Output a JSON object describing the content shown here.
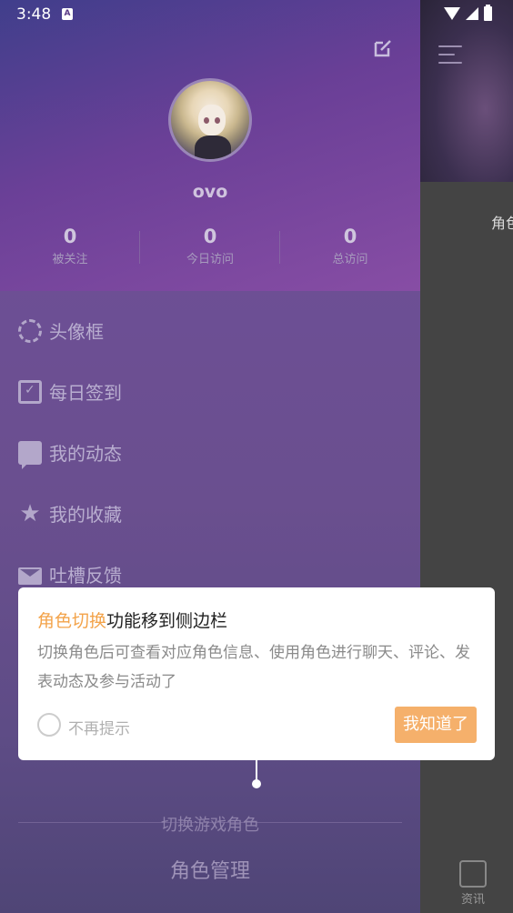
{
  "status_bar": {
    "time": "3:48",
    "notif_icon": "a-icon"
  },
  "drawer": {
    "username": "ovo",
    "stats": [
      {
        "value": "0",
        "label": "被关注"
      },
      {
        "value": "0",
        "label": "今日访问"
      },
      {
        "value": "0",
        "label": "总访问"
      }
    ],
    "menu": [
      {
        "label": "头像框",
        "icon": "avatar-frame-icon"
      },
      {
        "label": "每日签到",
        "icon": "calendar-check-icon"
      },
      {
        "label": "我的动态",
        "icon": "chat-icon"
      },
      {
        "label": "我的收藏",
        "icon": "star-icon"
      },
      {
        "label": "吐槽反馈",
        "icon": "mail-icon"
      }
    ],
    "switch_game": "切换游戏角色",
    "role_manage": "角色管理"
  },
  "main": {
    "side_text": "角色",
    "tab_news_label": "资讯"
  },
  "dialog": {
    "title_highlight": "角色切换",
    "title_rest": "功能移到侧边栏",
    "body": "切换角色后可查看对应角色信息、使用角色进行聊天、评论、发表动态及参与活动了",
    "checkbox_label": "不再提示",
    "confirm_button": "我知道了"
  },
  "colors": {
    "accent": "#f5b06b",
    "highlight": "#f3a34a",
    "drawer": "#6d4f95"
  }
}
